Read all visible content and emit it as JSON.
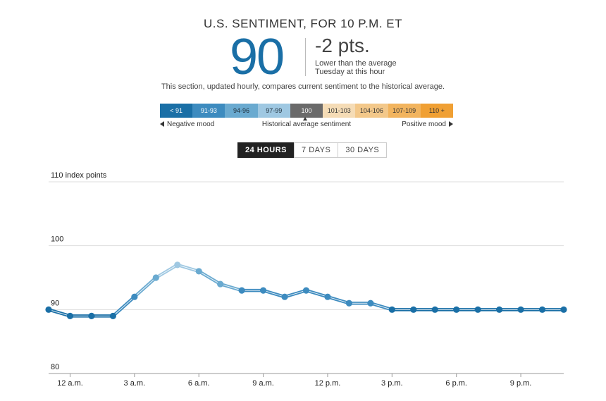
{
  "header": {
    "title": "U.S. SENTIMENT, FOR 10 P.M. ET",
    "score": "90",
    "delta": "-2 pts.",
    "delta_desc_line1": "Lower than the average",
    "delta_desc_line2": "Tuesday at this hour",
    "subtitle": "This section, updated hourly, compares current sentiment to the historical average."
  },
  "legend": {
    "segments": [
      {
        "label": "< 91",
        "bg": "#1a6fa6",
        "fg": "#ffffff"
      },
      {
        "label": "91-93",
        "bg": "#3d8bbf",
        "fg": "#ffffff"
      },
      {
        "label": "94-96",
        "bg": "#6aaad0",
        "fg": "#1e2e3a"
      },
      {
        "label": "97-99",
        "bg": "#9fc8e2",
        "fg": "#1e2e3a"
      },
      {
        "label": "100",
        "bg": "#6a6a6a",
        "fg": "#ffffff"
      },
      {
        "label": "101-103",
        "bg": "#f5dcb6",
        "fg": "#333333"
      },
      {
        "label": "104-106",
        "bg": "#f3c88a",
        "fg": "#333333"
      },
      {
        "label": "107-109",
        "bg": "#f2b45e",
        "fg": "#333333"
      },
      {
        "label": "110 +",
        "bg": "#f0a034",
        "fg": "#333333"
      }
    ],
    "negative_label": "Negative mood",
    "average_label": "Historical average sentiment",
    "positive_label": "Positive mood"
  },
  "tabs": [
    {
      "label": "24 HOURS",
      "active": true
    },
    {
      "label": "7 DAYS",
      "active": false
    },
    {
      "label": "30 DAYS",
      "active": false
    }
  ],
  "chart_data": {
    "type": "line",
    "ylabel": "index points",
    "ylim": [
      80,
      110
    ],
    "yticks": [
      {
        "value": 110,
        "label": "110 index points"
      },
      {
        "value": 100,
        "label": "100"
      },
      {
        "value": 90,
        "label": "90"
      },
      {
        "value": 80,
        "label": "80"
      }
    ],
    "xticks": [
      {
        "index": 1,
        "label": "12 a.m."
      },
      {
        "index": 4,
        "label": "3 a.m."
      },
      {
        "index": 7,
        "label": "6 a.m."
      },
      {
        "index": 10,
        "label": "9 a.m."
      },
      {
        "index": 13,
        "label": "12 p.m."
      },
      {
        "index": 16,
        "label": "3 p.m."
      },
      {
        "index": 19,
        "label": "6 p.m."
      },
      {
        "index": 22,
        "label": "9 p.m."
      }
    ],
    "grid": true,
    "values": [
      90,
      89,
      89,
      89,
      92,
      95,
      97,
      96,
      94,
      93,
      93,
      92,
      93,
      92,
      91,
      91,
      90,
      90,
      90,
      90,
      90,
      90,
      90,
      90,
      90
    ],
    "colors": {
      "line": "#1a6fa6",
      "line_mid": "#3d8bbf",
      "line_light": "#6aaad0",
      "line_lightest": "#9fc8e2",
      "grid": "#dddddd",
      "baseline": "#999999"
    }
  }
}
